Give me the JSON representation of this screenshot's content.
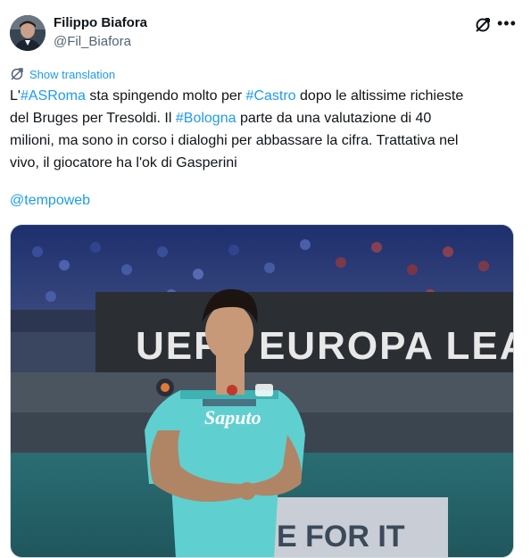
{
  "author": {
    "name": "Filippo Biafora",
    "handle": "@Fil_Biafora"
  },
  "icons": {
    "grok": "grok-icon",
    "more": "more-icon",
    "translate": "translate-icon"
  },
  "more_glyph": "•••",
  "translation_label": "Show translation",
  "tweet_text": {
    "line1_a": "L'",
    "tag_asroma": "#ASRoma",
    "line1_b": " sta spingendo molto per ",
    "tag_castro": "#Castro",
    "line1_c": " dopo le altissime richieste",
    "line2_a": "del Bruges per Tresoldi. Il ",
    "tag_bologna": "#Bologna",
    "line2_b": " parte da una valutazione di 40",
    "line3": "milioni, ma sono in corso i dialoghi per abbassare la cifra. Trattativa nel",
    "line4": "vivo, il giocatore ha l'ok di Gasperini"
  },
  "mention": "@tempoweb",
  "media": {
    "banner_text": "UEFA EUROPA LEAGUE",
    "sponsor": "Saputo",
    "bottom_board": "E FOR IT",
    "colors": {
      "jersey": "#5fd0cf",
      "sky_stands": "#2a3f8a",
      "banner": "#2b2f33"
    }
  }
}
